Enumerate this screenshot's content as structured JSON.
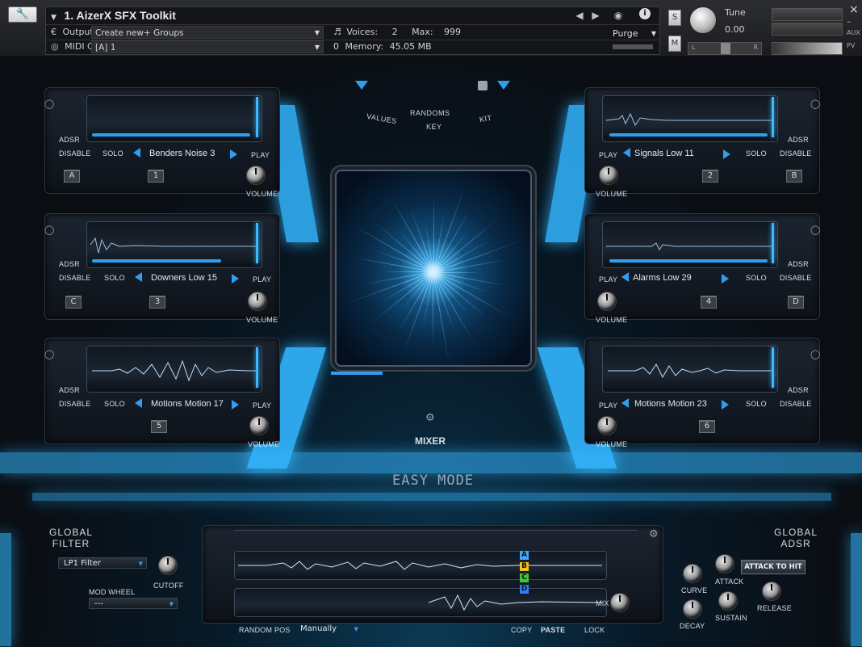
{
  "header": {
    "instrument_title": "1. AizerX SFX Toolkit",
    "output_label": "Output:",
    "output_value": "Create new+ Groups",
    "midi_label": "MIDI Ch:",
    "midi_value": "[A] 1",
    "voices_label": "Voices:",
    "voices_value": "2",
    "max_label": "Max:",
    "max_value": "999",
    "memory_label": "Memory:",
    "memory_value": "45.05 MB",
    "purge_label": "Purge",
    "solo_btn": "S",
    "mute_btn": "M",
    "tune_label": "Tune",
    "tune_value": "0.00",
    "pan_left": "L",
    "pan_right": "R",
    "aux_label": "AUX",
    "pv_label": "PV",
    "minimize": "–",
    "close": "×"
  },
  "top_controls": {
    "values": "VALUES",
    "randoms": "RANDOMS",
    "key": "KEY",
    "kit": "KIT"
  },
  "slots": [
    {
      "letter": "A",
      "number": "1",
      "name": "Benders Noise 3",
      "adsr": "ADSR",
      "disable": "DISABLE",
      "solo": "SOLO",
      "play": "PLAY",
      "volume": "VOLUME"
    },
    {
      "letter": "B",
      "number": "2",
      "name": "Signals Low 11",
      "adsr": "ADSR",
      "disable": "DISABLE",
      "solo": "SOLO",
      "play": "PLAY",
      "volume": "VOLUME"
    },
    {
      "letter": "C",
      "number": "3",
      "name": "Downers Low 15",
      "adsr": "ADSR",
      "disable": "DISABLE",
      "solo": "SOLO",
      "play": "PLAY",
      "volume": "VOLUME"
    },
    {
      "letter": "D",
      "number": "4",
      "name": "Alarms Low 29",
      "adsr": "ADSR",
      "disable": "DISABLE",
      "solo": "SOLO",
      "play": "PLAY",
      "volume": "VOLUME"
    },
    {
      "letter": "",
      "number": "5",
      "name": "Motions Motion 17",
      "adsr": "ADSR",
      "disable": "DISABLE",
      "solo": "SOLO",
      "play": "PLAY",
      "volume": "VOLUME"
    },
    {
      "letter": "",
      "number": "6",
      "name": "Motions Motion 23",
      "adsr": "ADSR",
      "disable": "DISABLE",
      "solo": "SOLO",
      "play": "PLAY",
      "volume": "VOLUME"
    }
  ],
  "center": {
    "mixer": "MIXER",
    "easy_mode": "EASY MODE"
  },
  "global_filter": {
    "title_line1": "GLOBAL",
    "title_line2": "FILTER",
    "filter_type": "LP1 Filter",
    "cutoff": "CUTOFF",
    "mod_wheel": "MOD WHEEL",
    "mod_value": "---"
  },
  "global_adsr": {
    "title_line1": "GLOBAL",
    "title_line2": "ADSR",
    "attack_to_hit": "ATTACK TO HIT",
    "attack": "ATTACK",
    "curve": "CURVE",
    "decay": "DECAY",
    "sustain": "SUSTAIN",
    "release": "RELEASE"
  },
  "bottom": {
    "random_pos": "RANDOM POS",
    "random_pos_value": "Manually",
    "copy": "COPY",
    "paste": "PASTE",
    "lock": "LOCK",
    "mix": "MIX",
    "letters": [
      "A",
      "B",
      "C",
      "D"
    ],
    "letter_colors": [
      "#3fa7ff",
      "#f2c21b",
      "#3cc83c",
      "#2f7dff"
    ]
  },
  "colors": {
    "accent": "#2f9ef0",
    "glow": "#33b6ff"
  }
}
